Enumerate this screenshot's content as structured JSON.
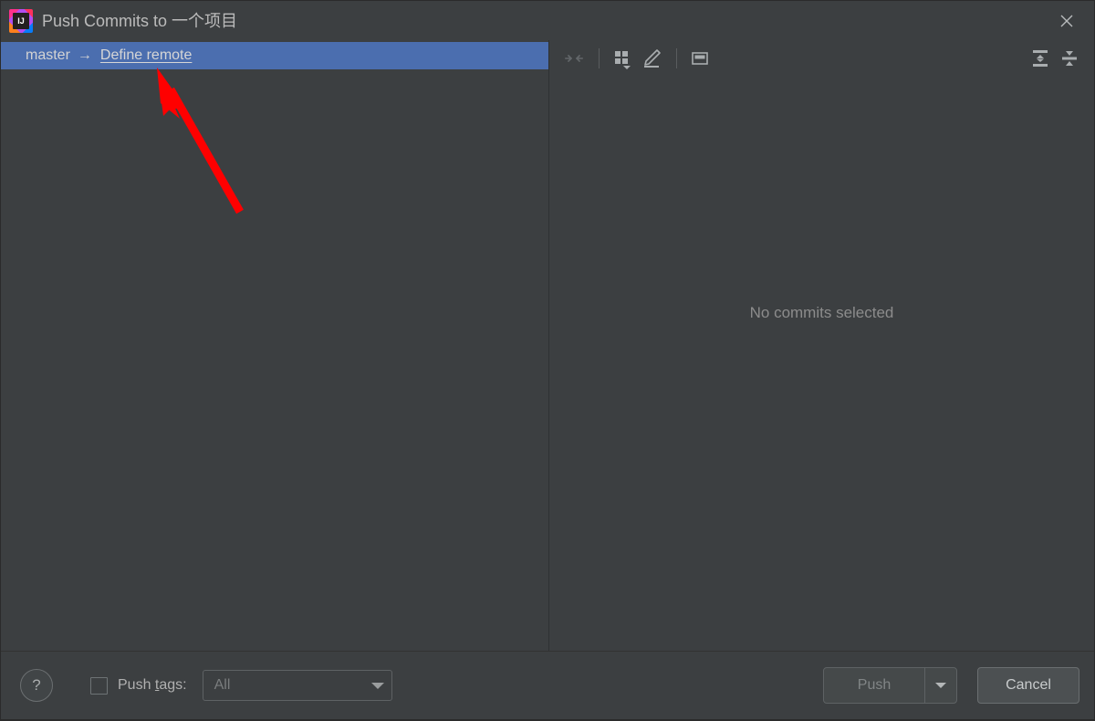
{
  "window": {
    "title": "Push Commits to 一个项目",
    "app_icon": "intellij-idea-icon",
    "app_icon_text": "IJ",
    "close_icon": "close-icon"
  },
  "colors": {
    "dialog_bg": "#3c3f41",
    "selection_blue": "#4b6eaf",
    "text_primary": "#bbbbbb",
    "text_dim": "#8c8c8c",
    "annotation_red": "#ff0000"
  },
  "left_pane": {
    "branches": [
      {
        "local_branch": "master",
        "arrow": "→",
        "remote_link": "Define remote",
        "selected": true
      }
    ]
  },
  "details_toolbar": {
    "buttons": [
      {
        "name": "collapse-arrows-icon",
        "label": "Collapse",
        "disabled": true
      },
      {
        "name": "grid-view-icon",
        "label": "View options",
        "disabled": false
      },
      {
        "name": "pencil-edit-icon",
        "label": "Edit",
        "disabled": false
      },
      {
        "name": "preview-panel-icon",
        "label": "Preview",
        "disabled": false
      },
      {
        "name": "expand-all-icon",
        "label": "Expand All",
        "disabled": false
      },
      {
        "name": "collapse-all-icon",
        "label": "Collapse All",
        "disabled": false
      }
    ]
  },
  "details_pane": {
    "empty_message": "No commits selected"
  },
  "bottom_bar": {
    "help_label": "?",
    "push_tags_checkbox_checked": false,
    "push_tags_label_before": "Push ",
    "push_tags_label_mnemonic": "t",
    "push_tags_label_after": "ags:",
    "push_tags_value": "All",
    "push_tags_options": [
      "All"
    ],
    "push_label": "Push",
    "push_dropdown_icon": "chevron-down-icon",
    "cancel_label": "Cancel"
  }
}
